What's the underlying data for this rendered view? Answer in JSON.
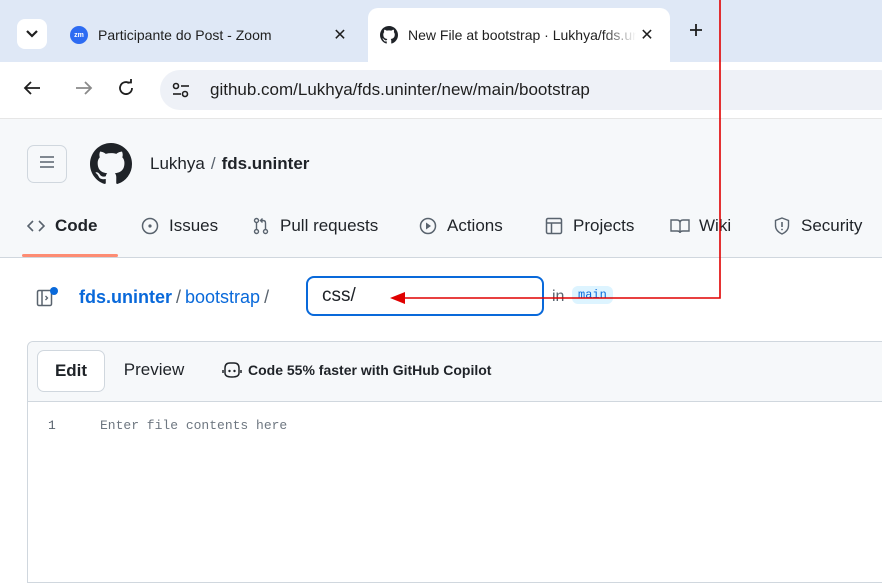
{
  "browser": {
    "tabs": [
      {
        "title": "Participante do Post - Zoom",
        "favicon": "zoom-icon",
        "active": false
      },
      {
        "title": "New File at bootstrap · Lukhya/fds.uninter",
        "favicon": "github-icon",
        "active": true
      }
    ],
    "zoom_favicon_text": "zm",
    "url": "github.com/Lukhya/fds.uninter/new/main/bootstrap"
  },
  "github": {
    "owner": "Lukhya",
    "separator": "/",
    "repo": "fds.uninter",
    "nav": [
      {
        "label": "Code",
        "icon": "code-icon",
        "selected": true
      },
      {
        "label": "Issues",
        "icon": "issue-opened-icon",
        "selected": false
      },
      {
        "label": "Pull requests",
        "icon": "git-pull-request-icon",
        "selected": false
      },
      {
        "label": "Actions",
        "icon": "play-icon",
        "selected": false
      },
      {
        "label": "Projects",
        "icon": "table-icon",
        "selected": false
      },
      {
        "label": "Wiki",
        "icon": "book-icon",
        "selected": false
      },
      {
        "label": "Security",
        "icon": "shield-icon",
        "selected": false
      }
    ]
  },
  "path": {
    "repo": "fds.uninter",
    "directory": "bootstrap",
    "filename_value": "css/",
    "in_label": "in",
    "branch": "main"
  },
  "editor": {
    "edit_tab": "Edit",
    "preview_tab": "Preview",
    "copilot_text": "Code 55% faster with GitHub Copilot",
    "line_number": "1",
    "placeholder": "Enter file contents here"
  },
  "colors": {
    "tabstrip_bg": "#dfe8f6",
    "link_blue": "#0969da",
    "selected_underline": "#fd8c73",
    "annotation_red": "#e00000"
  }
}
